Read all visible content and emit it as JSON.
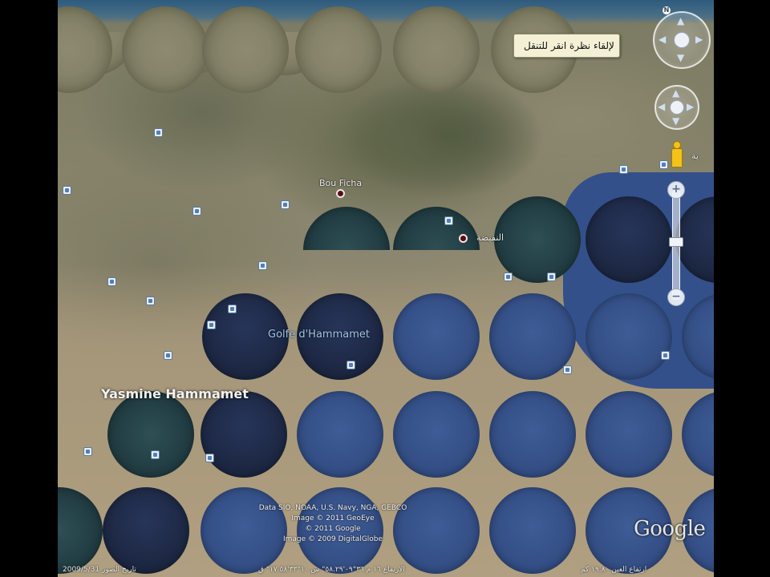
{
  "map": {
    "labels": {
      "gulf": "Golfe d'Hammamet",
      "town_west": "Yasmine Hammamet",
      "town_north": "Bou Ficha",
      "arabic_city": "النفيضة",
      "right_edge": "ية"
    }
  },
  "tooltip": {
    "text_a": "انقر للتنقل",
    "text_b": "لإلقاء نظرة"
  },
  "controls": {
    "zoom_in": "+",
    "zoom_out": "−",
    "north": "N"
  },
  "attribution": {
    "line1": "Data SIO, NOAA, U.S. Navy, NGA, GEBCO",
    "line2": "Image © 2011 GeoEye",
    "line3": "© 2011 Google",
    "line4": "Image © 2009 DigitalGlobe"
  },
  "branding": {
    "logo": "Google"
  },
  "status": {
    "imagery_date": "2009/5/31 تاريخ الصور",
    "coords": "الارتفاع ١٦ م   ٣٦°٠٩'٥٨.٢٩\" ش   ١٠°٣٣'١٧.٥٨\" ق",
    "eye_alt": "ارتفاع العين ١٩.٨٠ كم"
  }
}
